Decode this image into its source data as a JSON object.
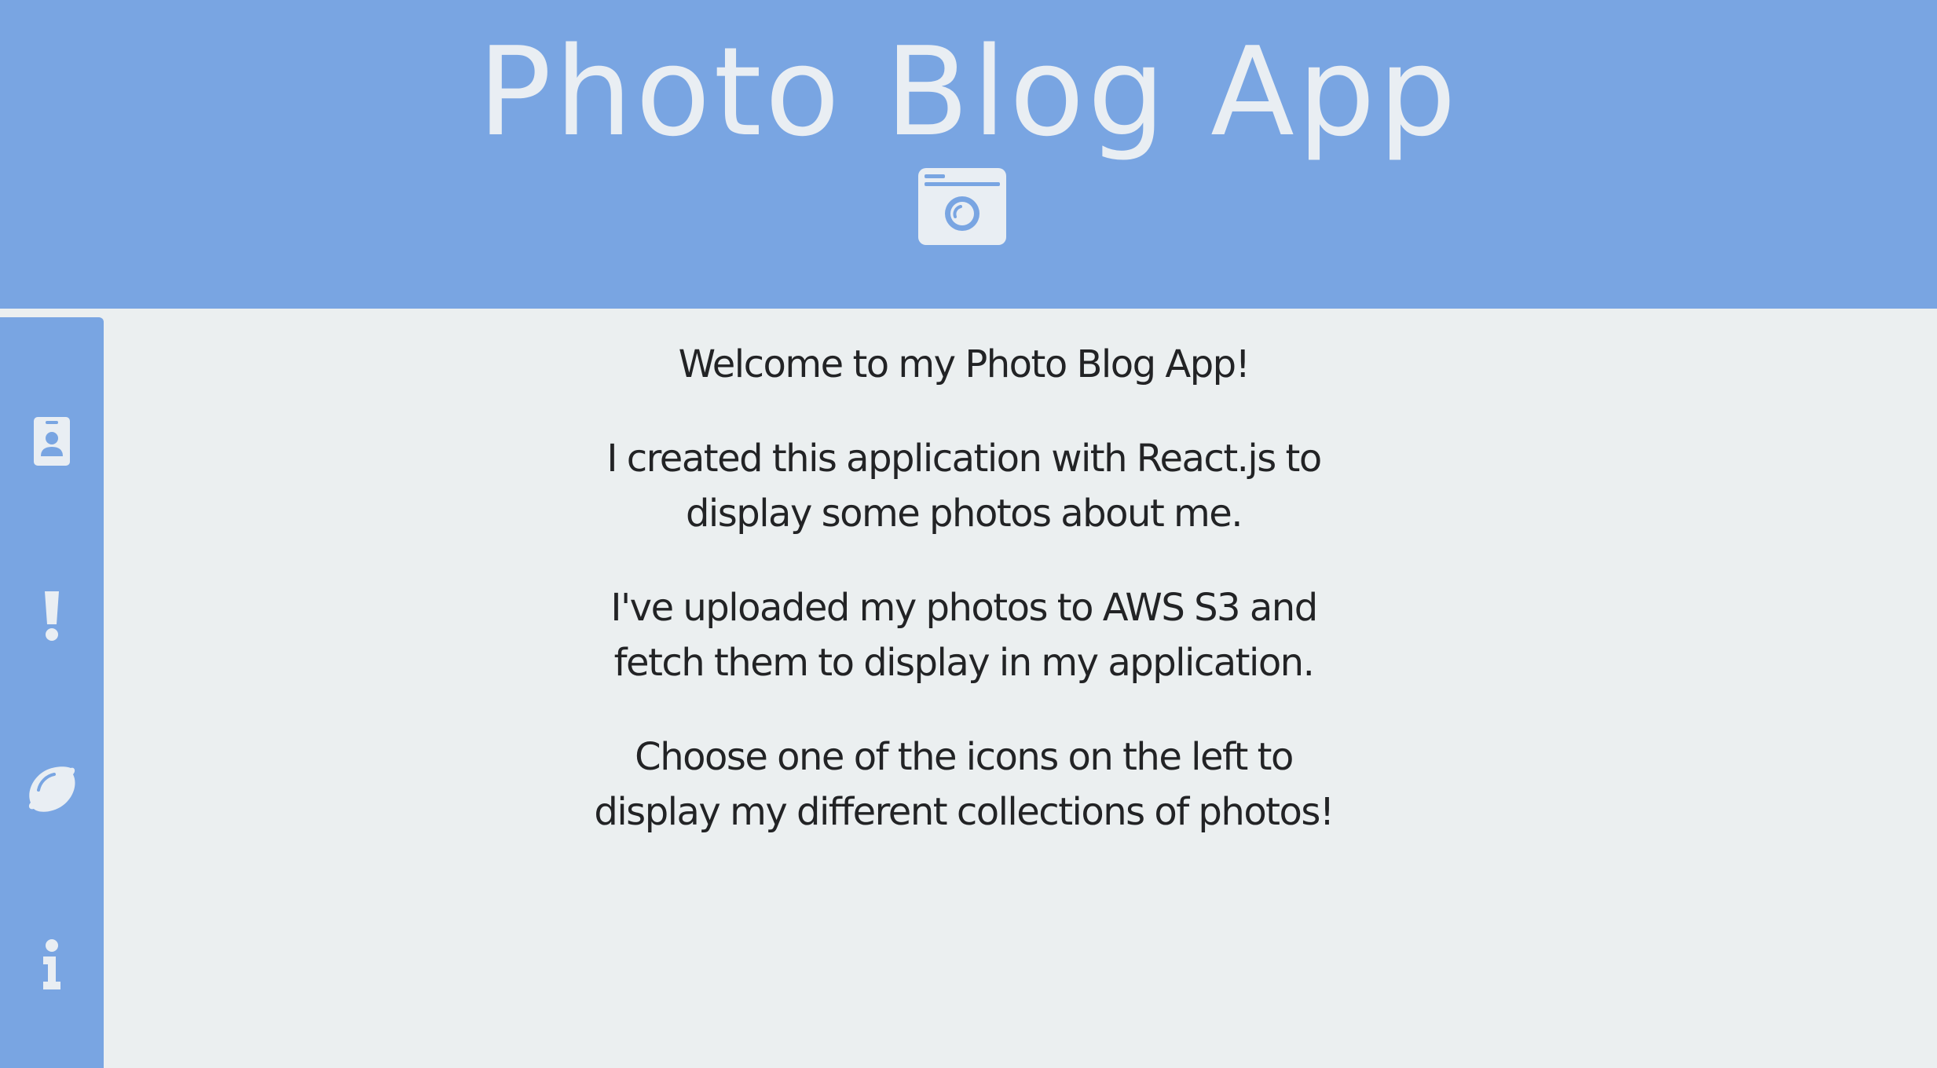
{
  "header": {
    "title": "Photo Blog App",
    "logo_icon": "camera-icon"
  },
  "sidebar": {
    "items": [
      {
        "icon": "id-badge-icon",
        "name": "sidebar-item-about-me"
      },
      {
        "icon": "exclamation-icon",
        "name": "sidebar-item-alert"
      },
      {
        "icon": "lemon-icon",
        "name": "sidebar-item-food"
      },
      {
        "icon": "info-icon",
        "name": "sidebar-item-info"
      }
    ]
  },
  "main": {
    "welcome": "Welcome to my Photo Blog App!",
    "p1_line1": "I created this application with React.js to",
    "p1_line2": "display some photos about me.",
    "p2_line1": "I've uploaded my photos to AWS S3 and",
    "p2_line2": "fetch them to display in my application.",
    "p3_line1": "Choose one of the icons on the left to",
    "p3_line2": "display my different collections of photos!"
  },
  "colors": {
    "header_bg": "#79a5e2",
    "page_bg": "#ebeff0",
    "icon_fg": "#e9eef3",
    "text": "#222325"
  }
}
